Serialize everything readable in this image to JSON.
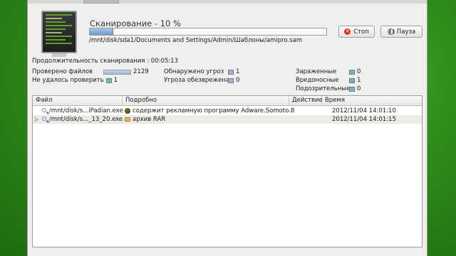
{
  "header": {
    "title": "Сканирование - 10 %",
    "progress_percent": 10,
    "current_file": "/mnt/disk/sda1/Documents and Settings/Admin/Шаблоны/amipro.sam",
    "stop_label": "Стоп",
    "pause_label": "Пауза"
  },
  "summary": {
    "duration_label": "Продолжительность сканирования",
    "duration_value": "00:05:13",
    "checked_label": "Проверено файлов",
    "checked_value": "2129",
    "failed_label": "Не удалось проверить",
    "failed_value": "1",
    "detected_label": "Обнаружено угроз",
    "detected_value": "1",
    "neutralized_label": "Угроза обезврежена",
    "neutralized_value": "0",
    "infected_label": "Зараженные",
    "infected_value": "0",
    "malicious_label": "Вредоносные",
    "malicious_value": "1",
    "suspicious_label": "Подозрительные",
    "suspicious_value": "0"
  },
  "colors": {
    "blue_swatch": "#a9b8d6",
    "teal_swatch": "#6fb7c0",
    "purple_swatch": "#b1a7d8"
  },
  "table": {
    "columns": [
      "Файл",
      "Подробно",
      "Действие",
      "Время"
    ],
    "rows": [
      {
        "file": "/mnt/disk/s...iPadian.exe",
        "detail": "содержит рекламную программу  Adware.Somoto.8",
        "action": "",
        "time": "2012/11/04 14:01:10",
        "detail_icon": "bug-icon",
        "expandable": false
      },
      {
        "file": "/mnt/disk/s..._13_20.exe",
        "detail": "архив  RAR",
        "action": "",
        "time": "2012/11/04 14:01:15",
        "detail_icon": "folder-icon",
        "expandable": true
      }
    ]
  }
}
